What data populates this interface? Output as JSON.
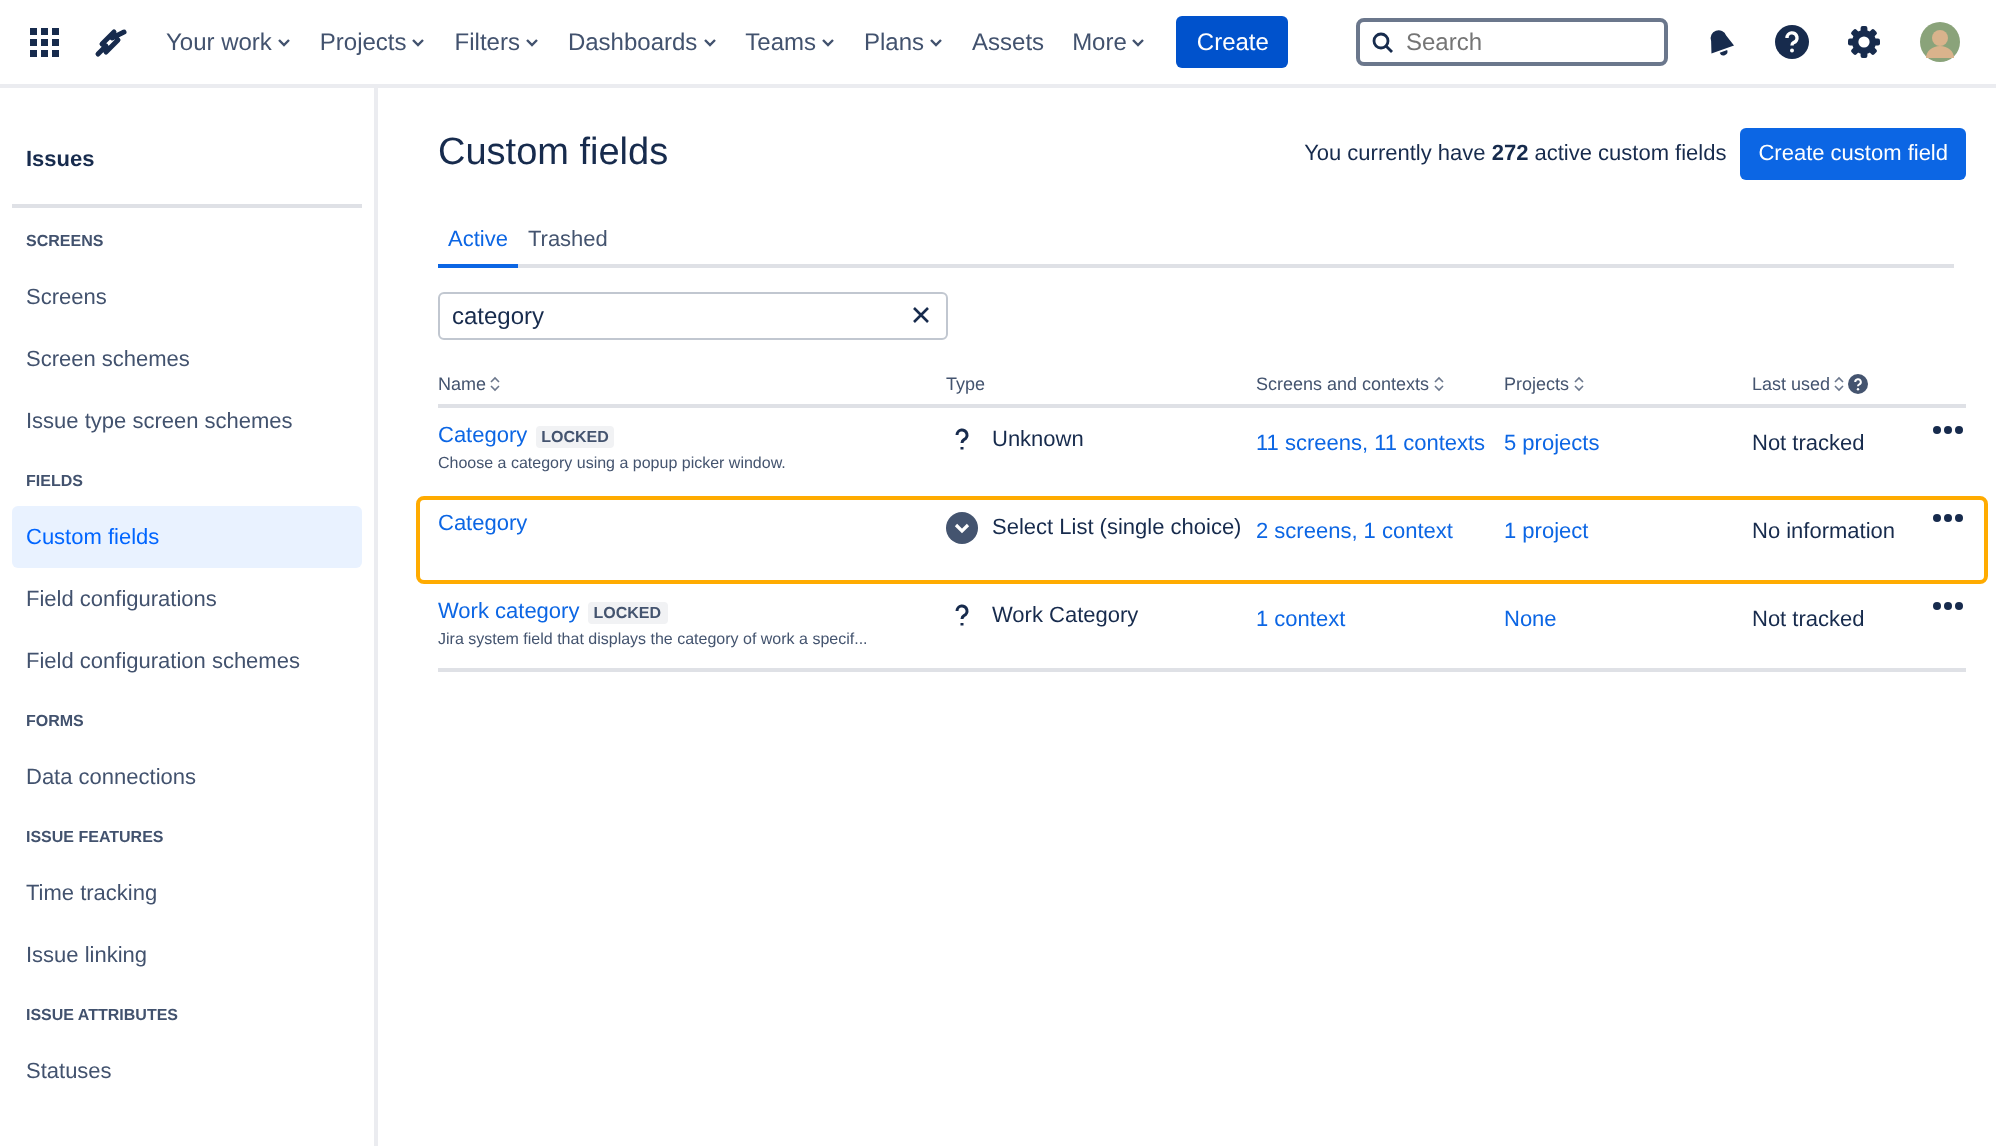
{
  "nav": {
    "items": [
      {
        "label": "Your work",
        "dropdown": true
      },
      {
        "label": "Projects",
        "dropdown": true
      },
      {
        "label": "Filters",
        "dropdown": true
      },
      {
        "label": "Dashboards",
        "dropdown": true
      },
      {
        "label": "Teams",
        "dropdown": true
      },
      {
        "label": "Plans",
        "dropdown": true
      },
      {
        "label": "Assets",
        "dropdown": false
      },
      {
        "label": "More",
        "dropdown": true
      }
    ],
    "create_button": "Create",
    "search": {
      "placeholder": "Search"
    }
  },
  "sidebar": {
    "title": "Issues",
    "sections": [
      {
        "heading": "SCREENS",
        "items": [
          {
            "label": "Screens",
            "selected": false
          },
          {
            "label": "Screen schemes",
            "selected": false
          },
          {
            "label": "Issue type screen schemes",
            "selected": false
          }
        ]
      },
      {
        "heading": "FIELDS",
        "items": [
          {
            "label": "Custom fields",
            "selected": true
          },
          {
            "label": "Field configurations",
            "selected": false
          },
          {
            "label": "Field configuration schemes",
            "selected": false
          }
        ]
      },
      {
        "heading": "FORMS",
        "items": [
          {
            "label": "Data connections",
            "selected": false
          }
        ]
      },
      {
        "heading": "ISSUE FEATURES",
        "items": [
          {
            "label": "Time tracking",
            "selected": false
          },
          {
            "label": "Issue linking",
            "selected": false
          }
        ]
      },
      {
        "heading": "ISSUE ATTRIBUTES",
        "items": [
          {
            "label": "Statuses",
            "selected": false
          }
        ]
      }
    ]
  },
  "page": {
    "title": "Custom fields",
    "summary": "You currently have **272** active custom fields",
    "create_button": "Create custom field",
    "tabs": [
      {
        "label": "Active",
        "selected": true
      },
      {
        "label": "Trashed",
        "selected": false
      }
    ],
    "filter": {
      "value": "category"
    }
  },
  "table": {
    "columns": [
      {
        "label": "Name",
        "sortable": true,
        "help": false
      },
      {
        "label": "Type",
        "sortable": false,
        "help": false
      },
      {
        "label": "Screens and contexts",
        "sortable": true,
        "help": false
      },
      {
        "label": "Projects",
        "sortable": true,
        "help": false
      },
      {
        "label": "Last used",
        "sortable": true,
        "help": true
      }
    ],
    "rows": [
      {
        "name": "Category",
        "badge": "LOCKED",
        "description": "Choose a category using a popup picker window.",
        "kind": "unknown",
        "type": "Unknown",
        "screens": "11 screens, 11 contexts",
        "projects": "5 projects",
        "last_used": "Not tracked",
        "highlighted": false
      },
      {
        "name": "Category",
        "kind": "select",
        "type": "Select List (single choice)",
        "screens": "2 screens, 1 context",
        "projects": "1 project",
        "last_used": "No information",
        "highlighted": true
      },
      {
        "name": "Work category",
        "badge": "LOCKED",
        "description": "Jira system field that displays the category of work a specif...",
        "kind": "unknown",
        "type": "Work Category",
        "screens": "1 context",
        "projects": "None",
        "last_used": "Not tracked",
        "highlighted": false
      }
    ]
  }
}
